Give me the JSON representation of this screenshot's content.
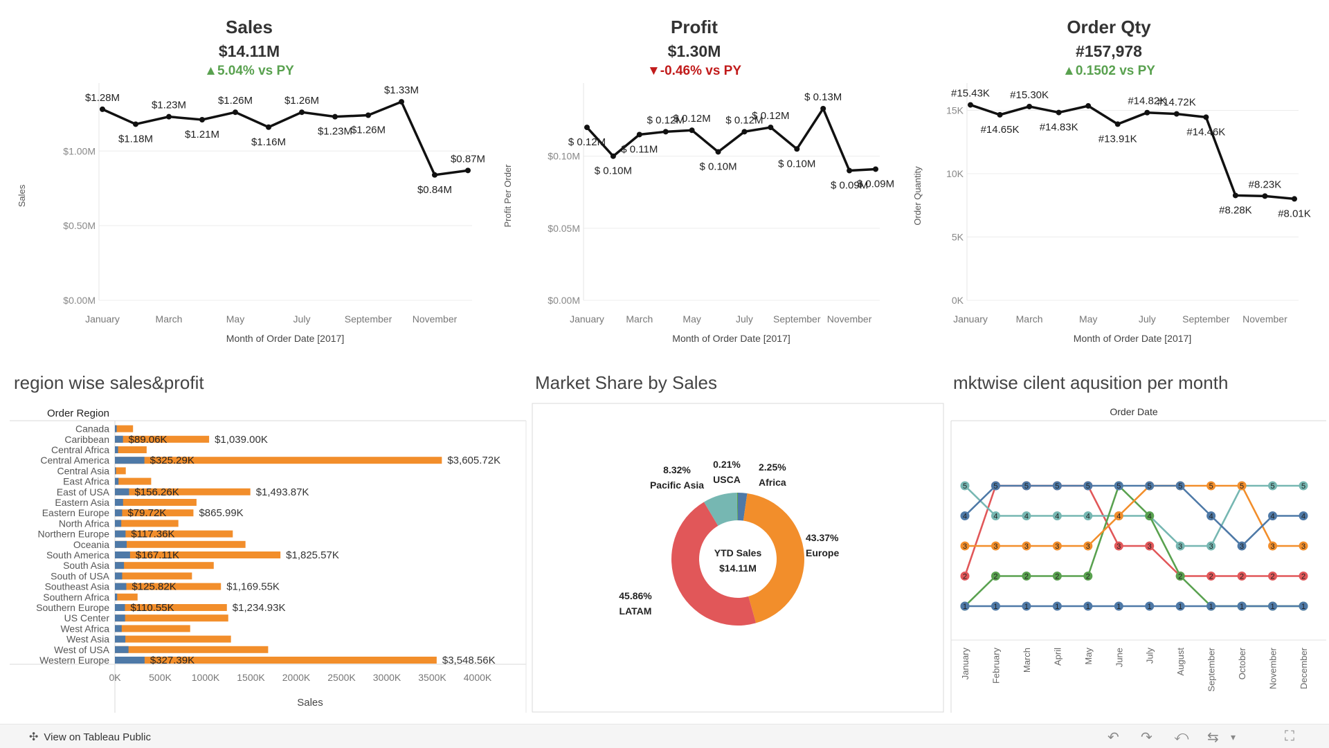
{
  "kpis": [
    {
      "title": "Sales",
      "value": "$14.11M",
      "delta": "▲5.04% vs PY",
      "delta_dir": "up"
    },
    {
      "title": "Profit",
      "value": "$1.30M",
      "delta": "▼-0.46% vs PY",
      "delta_dir": "down"
    },
    {
      "title": "Order Qty",
      "value": "#157,978",
      "delta": "▲0.1502 vs PY",
      "delta_dir": "up"
    }
  ],
  "months_short": [
    "January",
    "March",
    "May",
    "July",
    "September",
    "November"
  ],
  "sections": {
    "region": "region wise sales&profit",
    "market": "Market Share by Sales",
    "mktwise": "mktwise cilent aqusition per month"
  },
  "footer": {
    "link": "View on Tableau Public"
  },
  "chart_data": [
    {
      "type": "line",
      "id": "sales",
      "x": [
        "January",
        "February",
        "March",
        "April",
        "May",
        "June",
        "July",
        "August",
        "September",
        "October",
        "November",
        "December"
      ],
      "values": [
        1.28,
        1.18,
        1.23,
        1.21,
        1.26,
        1.16,
        1.26,
        1.23,
        1.24,
        1.33,
        0.84,
        0.87
      ],
      "labels": [
        "$1.28M",
        "$1.18M",
        "$1.23M",
        "$1.21M",
        "$1.26M",
        "$1.16M",
        "$1.26M",
        "$1.23M",
        "",
        "$1.26M",
        "$1.33M",
        "$0.84M",
        "$0.87M"
      ],
      "point_labels": [
        "$1.28M",
        "$1.18M",
        "$1.23M",
        "$1.21M",
        "$1.26M",
        "$1.16M",
        "$1.26M",
        "$1.23M",
        "$1.26M",
        "$1.33M",
        "$0.84M",
        "$0.87M"
      ],
      "ylabel": "Sales",
      "xlabel": "Month of Order Date [2017]",
      "yticks": [
        "$0.00M",
        "$0.50M",
        "$1.00M"
      ],
      "ylim": [
        0,
        1.4
      ]
    },
    {
      "type": "line",
      "id": "profit",
      "x": [
        "January",
        "February",
        "March",
        "April",
        "May",
        "June",
        "July",
        "August",
        "September",
        "October",
        "November",
        "December"
      ],
      "values": [
        0.12,
        0.1,
        0.115,
        0.117,
        0.118,
        0.103,
        0.117,
        0.12,
        0.105,
        0.133,
        0.09,
        0.091
      ],
      "point_labels": [
        "$ 0.12M",
        "$ 0.10M",
        "$ 0.11M",
        "$ 0.12M",
        "$ 0.12M",
        "$ 0.10M",
        "$ 0.12M",
        "$ 0.12M",
        "$ 0.10M",
        "$ 0.13M",
        "$ 0.09M",
        "$ 0.09M"
      ],
      "ylabel": "Profit Per Order",
      "xlabel": "Month of Order Date [2017]",
      "yticks": [
        "$0.00M",
        "$0.05M",
        "$0.10M"
      ],
      "ylim": [
        0,
        0.145
      ]
    },
    {
      "type": "line",
      "id": "qty",
      "x": [
        "January",
        "February",
        "March",
        "April",
        "May",
        "June",
        "July",
        "August",
        "September",
        "October",
        "November",
        "December"
      ],
      "values": [
        15.43,
        14.65,
        15.3,
        14.83,
        15.35,
        13.91,
        14.82,
        14.72,
        14.46,
        8.28,
        8.23,
        8.01
      ],
      "point_labels": [
        "#15.43K",
        "#14.65K",
        "#15.30K",
        "#14.83K",
        "",
        "#13.91K",
        "#14.82K",
        "#14.72K",
        "#14.46K",
        "#8.28K",
        "#8.23K",
        "#8.01K"
      ],
      "ylabel": "Order Quantity",
      "xlabel": "Month of Order Date [2017]",
      "yticks": [
        "0K",
        "5K",
        "10K",
        "15K"
      ],
      "ylim": [
        0,
        16.5
      ]
    },
    {
      "type": "bar",
      "id": "region",
      "axis_title": "Order Region",
      "categories": [
        "Canada",
        "Caribbean",
        "Central Africa",
        "Central America",
        "Central Asia",
        "East Africa",
        "East of USA",
        "Eastern Asia",
        "Eastern Europe",
        "North Africa",
        "Northern Europe",
        "Oceania",
        "South America",
        "South Asia",
        "South of  USA",
        "Southeast Asia",
        "Southern Africa",
        "Southern Europe",
        "US Center",
        "West Africa",
        "West Asia",
        "West of USA",
        "Western Europe"
      ],
      "series": [
        {
          "name": "Sales",
          "color": "#f28e2b",
          "values": [
            200,
            1039,
            350,
            3605.72,
            120,
            400,
            1493.87,
            900,
            865.99,
            700,
            1300,
            1440,
            1825.57,
            1090,
            850,
            1169.55,
            250,
            1234.93,
            1250,
            830,
            1280,
            1690,
            3548.56
          ]
        },
        {
          "name": "Profit",
          "color": "#4e79a7",
          "values": [
            20,
            89.06,
            35,
            325.29,
            12,
            40,
            156.26,
            90,
            79.72,
            70,
            117.36,
            130,
            167.11,
            100,
            80,
            125.82,
            25,
            110.55,
            112,
            75,
            115,
            150,
            327.39
          ]
        }
      ],
      "sales_labels": [
        "",
        "$1,039.00K",
        "",
        "$3,605.72K",
        "",
        "",
        "$1,493.87K",
        "",
        "$865.99K",
        "",
        "",
        "",
        "$1,825.57K",
        "",
        "",
        "$1,169.55K",
        "",
        "$1,234.93K",
        "",
        "",
        "",
        "",
        "$3,548.56K"
      ],
      "profit_labels": [
        "",
        "$89.06K",
        "",
        "$325.29K",
        "",
        "",
        "$156.26K",
        "",
        "$79.72K",
        "",
        "$117.36K",
        "",
        "$167.11K",
        "",
        "",
        "$125.82K",
        "",
        "$110.55K",
        "",
        "",
        "",
        "",
        "$327.39K"
      ],
      "xticks": [
        "0K",
        "500K",
        "1000K",
        "1500K",
        "2000K",
        "2500K",
        "3000K",
        "3500K",
        "4000K"
      ],
      "xlabel": "Sales",
      "xlim": [
        0,
        4000
      ]
    },
    {
      "type": "pie",
      "id": "market",
      "center": [
        "YTD Sales",
        "$14.11M"
      ],
      "slices": [
        {
          "name": "Africa",
          "pct": "2.25%",
          "value": 2.25,
          "color": "#4e79a7"
        },
        {
          "name": "Europe",
          "pct": "43.37%",
          "value": 43.37,
          "color": "#f28e2b"
        },
        {
          "name": "LATAM",
          "pct": "45.86%",
          "value": 45.86,
          "color": "#e15759"
        },
        {
          "name": "Pacific Asia",
          "pct": "8.32%",
          "value": 8.32,
          "color": "#76b7b2"
        },
        {
          "name": "USCA",
          "pct": "0.21%",
          "value": 0.21,
          "color": "#59a14f"
        }
      ]
    },
    {
      "type": "line",
      "id": "bump",
      "axis_title": "Order Date",
      "x": [
        "January",
        "February",
        "March",
        "April",
        "May",
        "June",
        "July",
        "August",
        "September",
        "October",
        "November",
        "December"
      ],
      "series": [
        {
          "color": "#e15759",
          "ranks": [
            2,
            5,
            5,
            5,
            5,
            3,
            3,
            2,
            2,
            2,
            2,
            2
          ]
        },
        {
          "color": "#76b7b2",
          "ranks": [
            5,
            4,
            4,
            4,
            4,
            4,
            4,
            3,
            3,
            5,
            5,
            5
          ]
        },
        {
          "color": "#59a14f",
          "ranks": [
            1,
            2,
            2,
            2,
            2,
            5,
            4,
            2,
            1,
            1,
            1,
            1
          ]
        },
        {
          "color": "#f28e2b",
          "ranks": [
            3,
            3,
            3,
            3,
            3,
            4,
            5,
            5,
            5,
            5,
            3,
            3
          ]
        },
        {
          "color": "#4e79a7",
          "ranks": [
            4,
            5,
            5,
            5,
            5,
            5,
            5,
            5,
            4,
            3,
            4,
            4
          ]
        },
        {
          "color": "#4e79a7",
          "ranks": [
            1,
            1,
            1,
            1,
            1,
            1,
            1,
            1,
            1,
            1,
            1,
            1
          ]
        }
      ]
    }
  ]
}
